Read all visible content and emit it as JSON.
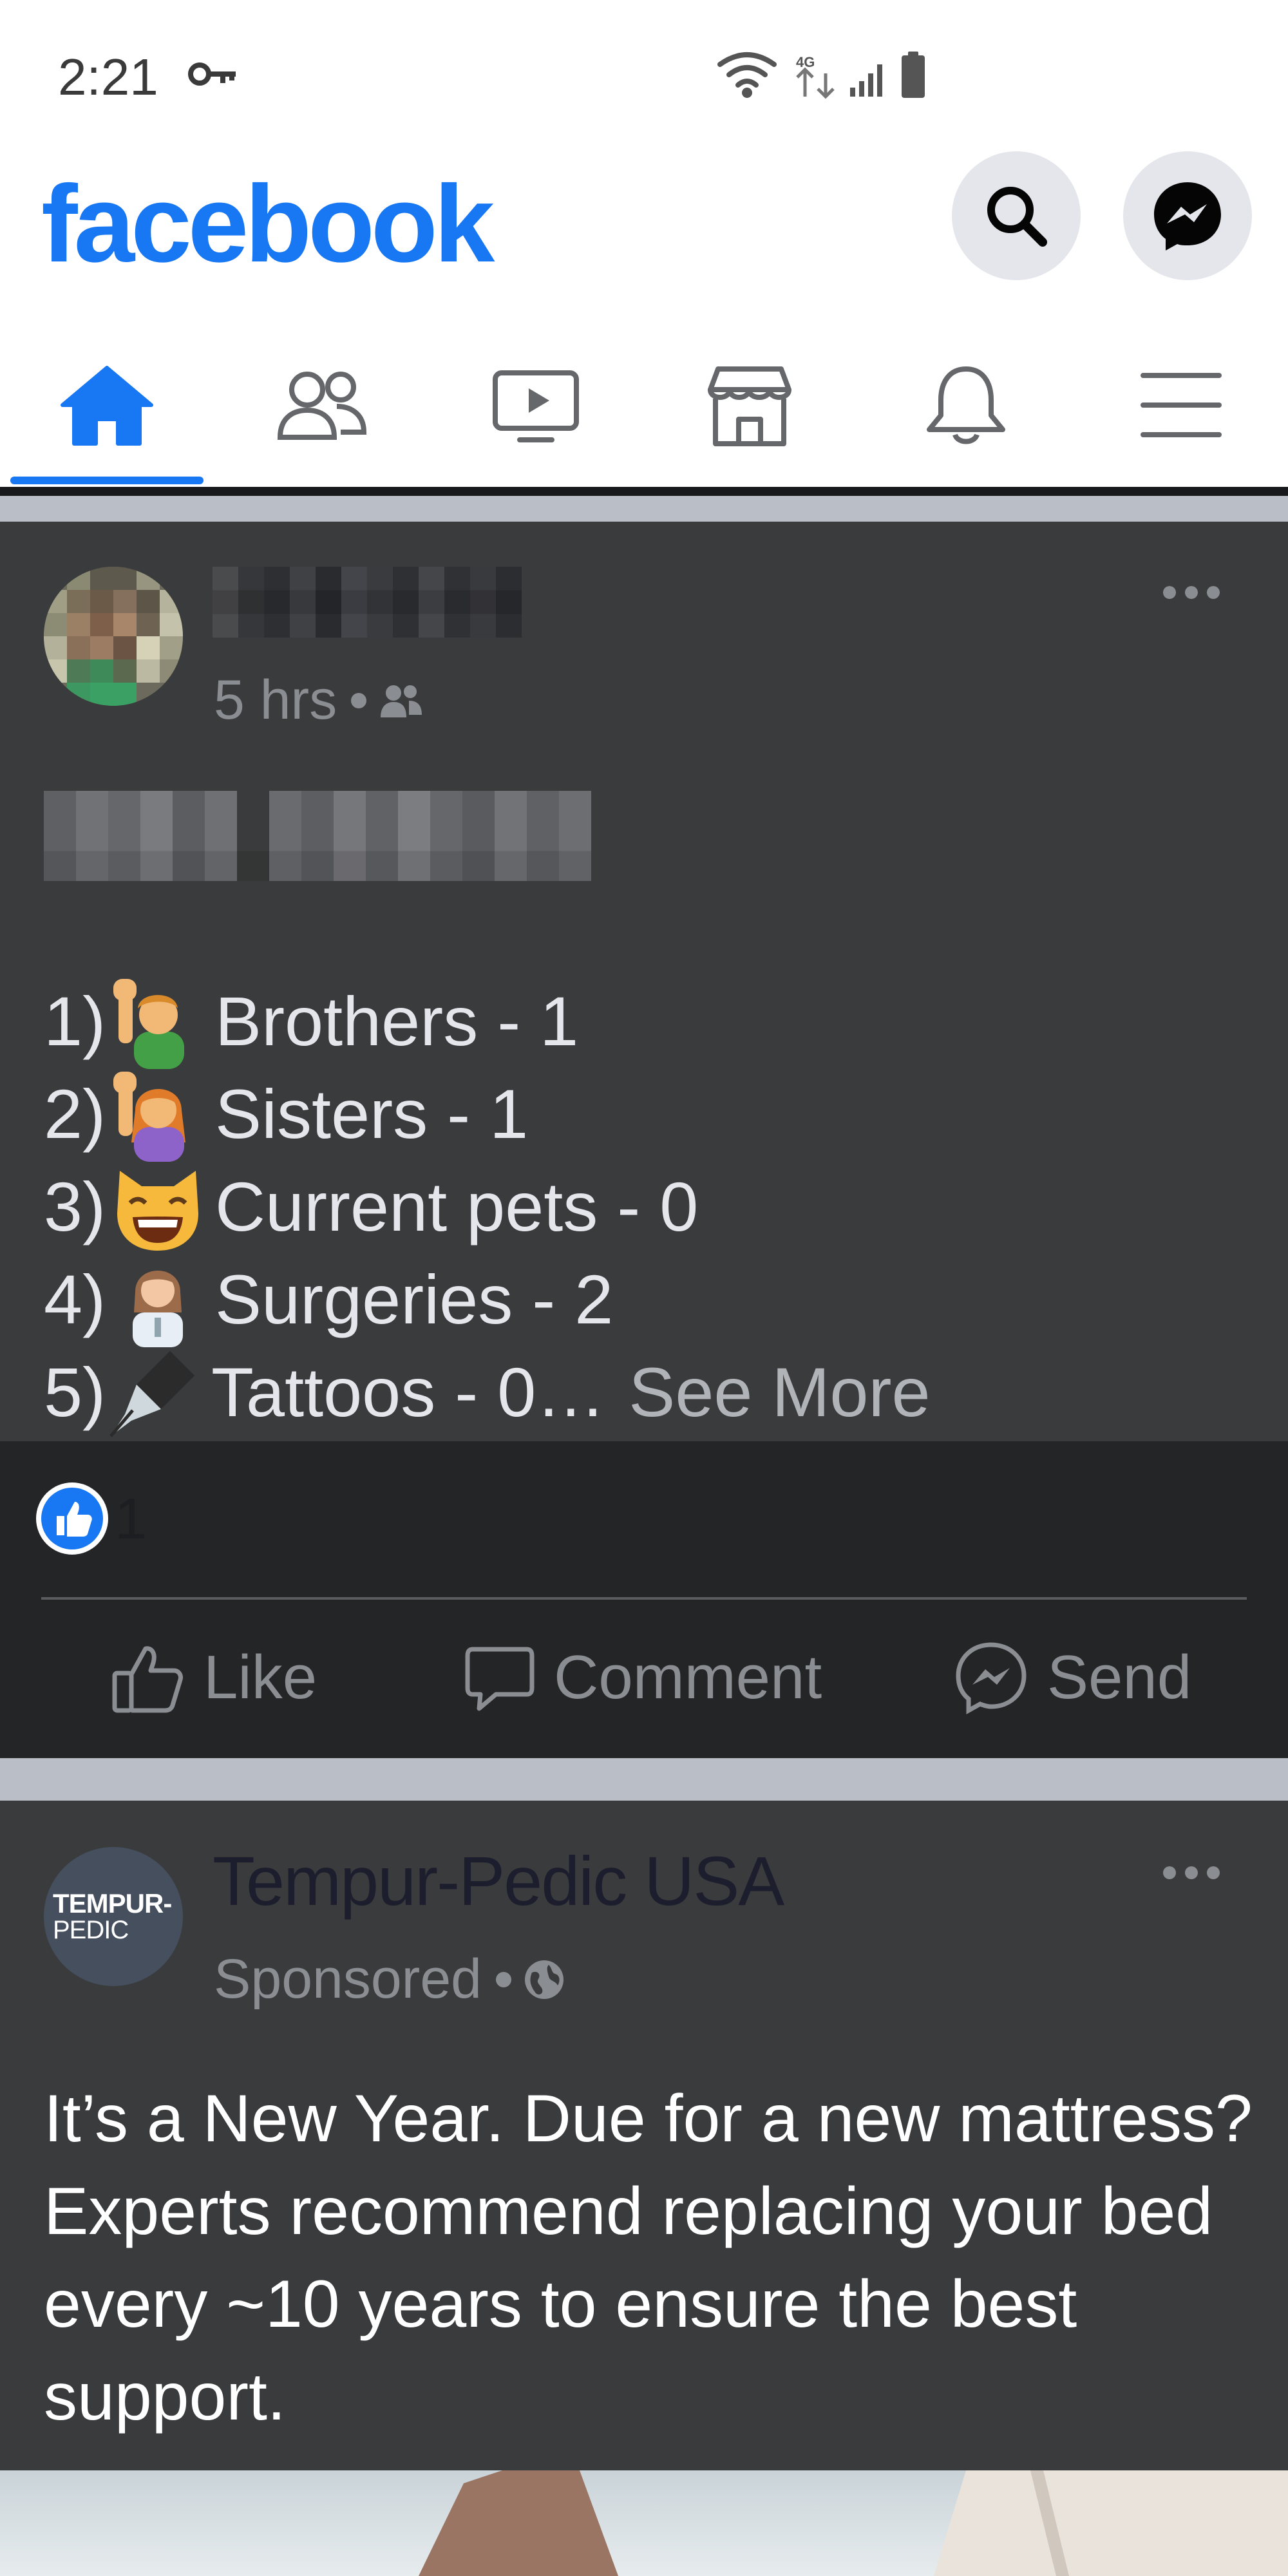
{
  "status_bar": {
    "time": "2:21",
    "network_label": "4G LTE"
  },
  "app_bar": {
    "logo": "facebook",
    "brand_color": "#1877f2"
  },
  "tabs": [
    {
      "name": "home",
      "icon": "home-icon",
      "active": true
    },
    {
      "name": "friends",
      "icon": "friends-icon",
      "active": false
    },
    {
      "name": "watch",
      "icon": "video-icon",
      "active": false
    },
    {
      "name": "marketplace",
      "icon": "store-icon",
      "active": false
    },
    {
      "name": "notifications",
      "icon": "bell-icon",
      "active": false
    },
    {
      "name": "menu",
      "icon": "hamburger-icon",
      "active": false
    }
  ],
  "post1": {
    "time": "5 hrs",
    "audience_icon": "friends-icon",
    "list": [
      {
        "num": "1)",
        "emoji": "man-raising-hand",
        "text": "Brothers - 1"
      },
      {
        "num": "2)",
        "emoji": "woman-raising-hand",
        "text": "Sisters - 1"
      },
      {
        "num": "3)",
        "emoji": "grinning-cat",
        "text": "Current pets - 0"
      },
      {
        "num": "4)",
        "emoji": "woman-health-worker",
        "text": "Surgeries -  2"
      },
      {
        "num": "5)",
        "emoji": "fountain-pen",
        "text": "Tattoos - 0…",
        "see_more": "See More"
      }
    ],
    "like_count": "1",
    "actions": {
      "like": "Like",
      "comment": "Comment",
      "send": "Send"
    }
  },
  "post2": {
    "avatar_line1": "TEMPUR-",
    "avatar_line2": "PEDIC",
    "name": "Tempur-Pedic USA",
    "meta": "Sponsored",
    "audience_icon": "globe-icon",
    "text": "It’s a New Year. Due for a new mattress? Experts recommend replacing your bed every ~10 years to ensure the best support."
  }
}
